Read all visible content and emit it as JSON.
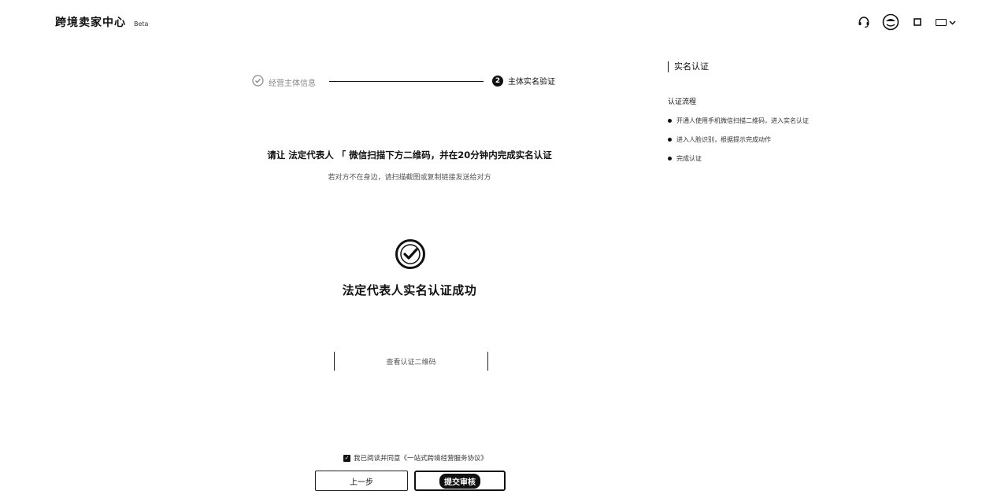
{
  "header": {
    "brand_title": "跨境卖家中心",
    "brand_badge": "Beta",
    "icons": [
      "headset-icon",
      "avatar-icon",
      "square-icon"
    ],
    "language_label": "二"
  },
  "steps": [
    {
      "label": "经营主体信息",
      "status": "done"
    },
    {
      "number": "2",
      "label": "主体实名验证",
      "status": "current"
    }
  ],
  "instruction": {
    "main": "请让 法定代表人 「      微信扫描下方二维码，并在20分钟内完成实名认证",
    "sub": "若对方不在身边，请扫描截图或复制链接发送给对方"
  },
  "success": {
    "text": "法定代表人实名认证成功"
  },
  "view_box": {
    "label": "查看认证二维码"
  },
  "agreement": {
    "checked": true,
    "text": "我已阅读并同意《一站式跨境经营服务协议》"
  },
  "buttons": {
    "prev_label": "上一步",
    "submit_label": "提交审核"
  },
  "side_panel": {
    "title": "实名认证",
    "subtitle": "认证流程",
    "items": [
      "开通人使用手机微信扫描二维码，进入实名认证",
      "进入人脸识别，根据提示完成动作",
      "完成认证"
    ]
  },
  "colors": {
    "primary": "#111111",
    "background": "#ffffff",
    "muted": "#888888"
  }
}
